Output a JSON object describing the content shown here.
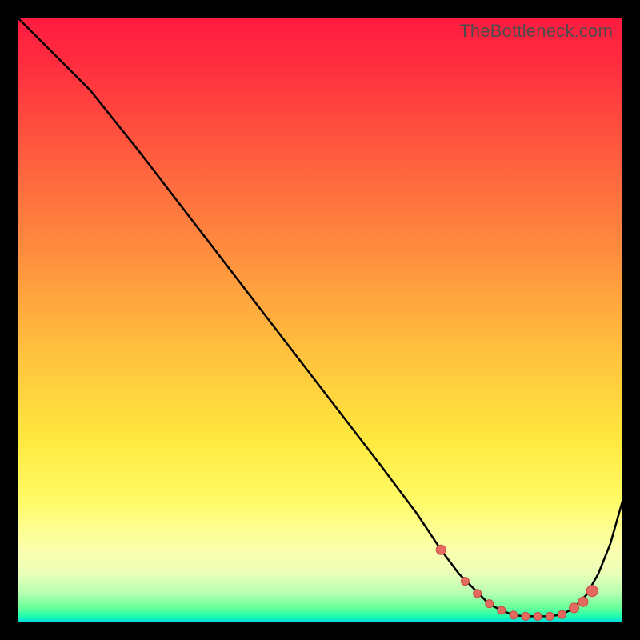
{
  "attribution": "TheBottleneck.com",
  "colors": {
    "curve": "#000000",
    "marker_fill": "#e4695e",
    "marker_stroke": "#c74b43"
  },
  "chart_data": {
    "type": "line",
    "title": "",
    "xlabel": "",
    "ylabel": "",
    "xlim": [
      0,
      100
    ],
    "ylim": [
      0,
      100
    ],
    "series": [
      {
        "name": "curve",
        "x": [
          0,
          4,
          8,
          12,
          20,
          30,
          40,
          50,
          60,
          66,
          70,
          73,
          76,
          78,
          80,
          82,
          84,
          86,
          88,
          90,
          92,
          94,
          96,
          98,
          100
        ],
        "y": [
          100,
          96,
          92,
          88,
          78,
          65,
          52,
          39,
          26,
          18,
          12,
          8,
          5,
          3,
          2,
          1.2,
          1,
          1,
          1,
          1.3,
          2.4,
          4.5,
          8,
          13,
          20
        ]
      }
    ],
    "markers": {
      "name": "highlight-points",
      "x": [
        70,
        74,
        76,
        78,
        80,
        82,
        84,
        86,
        88,
        90,
        92,
        93.5,
        95
      ],
      "y": [
        12,
        6.8,
        4.8,
        3.1,
        2,
        1.2,
        1,
        1,
        1,
        1.3,
        2.4,
        3.4,
        5.2
      ],
      "r": [
        6,
        5,
        5,
        5,
        5,
        5,
        5,
        5,
        5,
        5,
        6,
        6,
        7
      ]
    }
  }
}
